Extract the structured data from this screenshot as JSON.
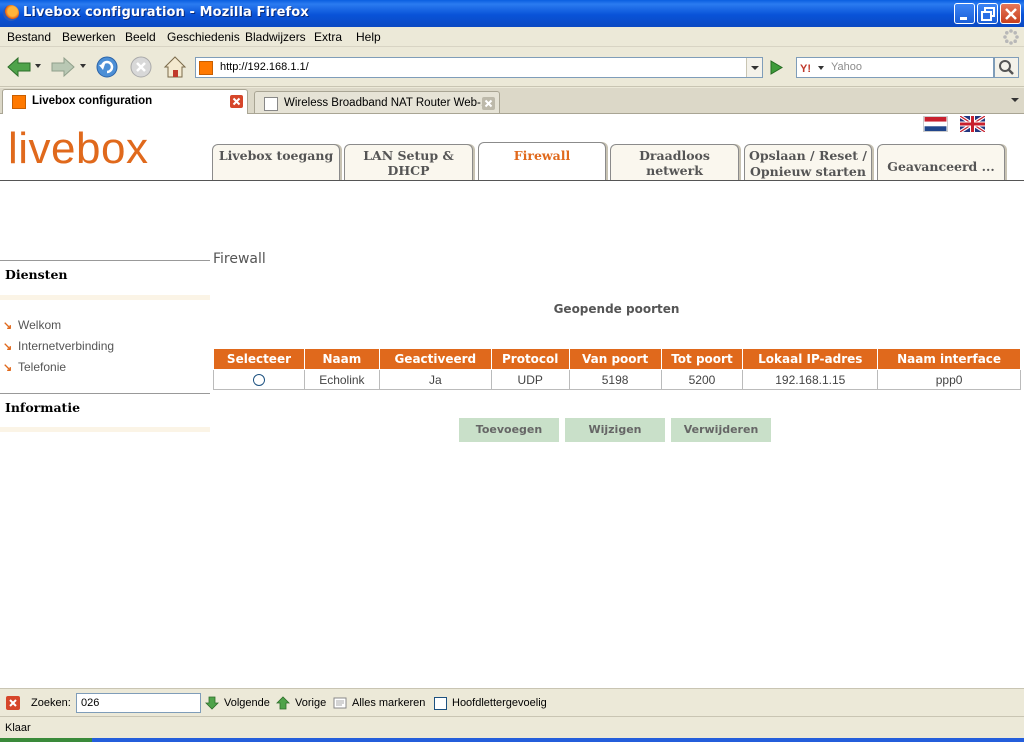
{
  "window": {
    "title": "Livebox configuration - Mozilla Firefox"
  },
  "menu": [
    "Bestand",
    "Bewerken",
    "Beeld",
    "Geschiedenis",
    "Bladwijzers",
    "Extra",
    "Help"
  ],
  "toolbar": {
    "url": "http://192.168.1.1/",
    "search_placeholder": "Yahoo"
  },
  "browser_tabs": [
    {
      "label": "Livebox configuration",
      "active": true
    },
    {
      "label": "Wireless Broadband NAT Router Web-...",
      "active": false
    }
  ],
  "site": {
    "logo": "livebox",
    "logo_color": "#e0691c",
    "nav_tabs": [
      {
        "label": "Livebox toegang"
      },
      {
        "label": "LAN Setup & DHCP"
      },
      {
        "label": "Firewall",
        "active": true
      },
      {
        "label": "Draadloos netwerk"
      },
      {
        "label_line1": "Opslaan / Reset /",
        "label_line2": "Opnieuw starten"
      },
      {
        "label": "Geavanceerd ..."
      }
    ]
  },
  "sidebar": {
    "section1": "Diensten",
    "links": [
      "Welkom",
      "Internetverbinding",
      "Telefonie"
    ],
    "section2": "Informatie"
  },
  "main": {
    "page_title": "Firewall",
    "heading": "Geopende poorten",
    "table": {
      "headers": [
        "Selecteer",
        "Naam",
        "Geactiveerd",
        "Protocol",
        "Van poort",
        "Tot poort",
        "Lokaal IP-adres",
        "Naam interface"
      ],
      "rows": [
        {
          "name": "Echolink",
          "active": "Ja",
          "protocol": "UDP",
          "from": "5198",
          "to": "5200",
          "ip": "192.168.1.15",
          "iface": "ppp0"
        }
      ],
      "header_color": "#e0691c"
    },
    "buttons": {
      "add": "Toevoegen",
      "edit": "Wijzigen",
      "delete": "Verwijderen"
    }
  },
  "findbar": {
    "label": "Zoeken:",
    "value": "026",
    "next": "Volgende",
    "prev": "Vorige",
    "highlight": "Alles markeren",
    "match_case": "Hoofdlettergevoelig"
  },
  "status": "Klaar"
}
